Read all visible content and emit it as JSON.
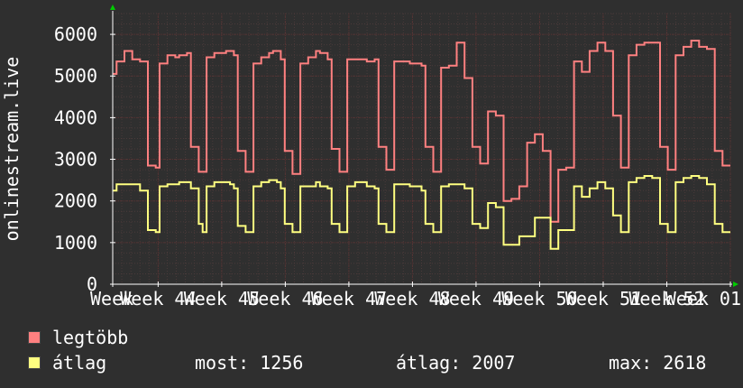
{
  "chart_data": {
    "type": "line",
    "ylabel": "onlinestream.live",
    "ylim": [
      0,
      6500
    ],
    "yticks": [
      0,
      1000,
      2000,
      3000,
      4000,
      5000,
      6000
    ],
    "xlim": [
      0,
      34
    ],
    "xticks": [
      {
        "x": 0,
        "label": "Week"
      },
      {
        "x": 2.5,
        "label": "Week 44"
      },
      {
        "x": 6,
        "label": "Week 45"
      },
      {
        "x": 9.5,
        "label": "Week 46"
      },
      {
        "x": 13,
        "label": "Week 47"
      },
      {
        "x": 16.5,
        "label": "Week 48"
      },
      {
        "x": 20,
        "label": "Week 49"
      },
      {
        "x": 23.5,
        "label": "Week 50"
      },
      {
        "x": 27,
        "label": "Week 51"
      },
      {
        "x": 30.5,
        "label": "Week 52"
      },
      {
        "x": 34,
        "label": "Week 01"
      }
    ],
    "grid": true,
    "colors": {
      "background": "#2f2f2f",
      "plot_background": "#2f2f2f",
      "grid_minor": "#4a3a3a",
      "grid_major": "#5a3030",
      "axis": "#ffffff",
      "arrow": "#00cc00",
      "max_series": "#ff8080",
      "avg_series": "#ffff80"
    },
    "series": [
      {
        "name": "legtöbb",
        "color": "#ff8080",
        "values": [
          5050,
          5350,
          5350,
          5600,
          5600,
          5400,
          5400,
          5350,
          5350,
          2850,
          2850,
          2800,
          5300,
          5300,
          5500,
          5500,
          5450,
          5500,
          5500,
          5550,
          3300,
          3300,
          2700,
          2700,
          5450,
          5450,
          5550,
          5550,
          5550,
          5600,
          5600,
          5500,
          3200,
          3200,
          2700,
          2700,
          5300,
          5300,
          5450,
          5450,
          5550,
          5600,
          5600,
          5400,
          3200,
          3200,
          2650,
          2650,
          5300,
          5300,
          5450,
          5450,
          5600,
          5550,
          5550,
          5400,
          3250,
          3250,
          2700,
          2700,
          5400,
          5400,
          5400,
          5400,
          5400,
          5350,
          5350,
          5400,
          3300,
          3300,
          2750,
          2750,
          5350,
          5350,
          5350,
          5350,
          5300,
          5300,
          5300,
          5250,
          3300,
          3300,
          2700,
          2700,
          5200,
          5200,
          5250,
          5250,
          5800,
          5800,
          4950,
          4950,
          3300,
          3300,
          2900,
          2900,
          4150,
          4150,
          4050,
          4050,
          2000,
          2000,
          2050,
          2050,
          2350,
          2350,
          3400,
          3400,
          3600,
          3600,
          3200,
          3200,
          1500,
          1500,
          2750,
          2750,
          2800,
          2800,
          5350,
          5350,
          5100,
          5100,
          5600,
          5600,
          5800,
          5800,
          5600,
          5600,
          4050,
          4050,
          2800,
          2800,
          5500,
          5500,
          5750,
          5750,
          5800,
          5800,
          5800,
          5800,
          3300,
          3300,
          2750,
          2750,
          5500,
          5500,
          5700,
          5700,
          5850,
          5850,
          5700,
          5700,
          5650,
          5650,
          3200,
          3200,
          2850,
          2850
        ]
      },
      {
        "name": "átlag",
        "color": "#ffff80",
        "values": [
          2250,
          2400,
          2400,
          2400,
          2400,
          2400,
          2400,
          2250,
          2250,
          1300,
          1300,
          1250,
          2350,
          2350,
          2400,
          2400,
          2400,
          2450,
          2450,
          2450,
          2300,
          2300,
          1450,
          1250,
          2350,
          2350,
          2450,
          2450,
          2450,
          2450,
          2400,
          2300,
          1400,
          1400,
          1250,
          1250,
          2350,
          2350,
          2450,
          2450,
          2500,
          2500,
          2450,
          2300,
          1450,
          1450,
          1250,
          1250,
          2350,
          2350,
          2350,
          2350,
          2450,
          2350,
          2350,
          2300,
          1450,
          1450,
          1250,
          1250,
          2350,
          2350,
          2450,
          2450,
          2450,
          2350,
          2350,
          2300,
          1450,
          1450,
          1250,
          1250,
          2400,
          2400,
          2400,
          2400,
          2350,
          2350,
          2350,
          2250,
          1450,
          1450,
          1250,
          1250,
          2350,
          2350,
          2400,
          2400,
          2400,
          2400,
          2300,
          2300,
          1450,
          1450,
          1350,
          1350,
          1950,
          1950,
          1850,
          1850,
          950,
          950,
          950,
          950,
          1150,
          1150,
          1150,
          1150,
          1600,
          1600,
          1600,
          1600,
          850,
          850,
          1300,
          1300,
          1300,
          1300,
          2350,
          2350,
          2100,
          2100,
          2300,
          2300,
          2450,
          2450,
          2300,
          2300,
          1650,
          1650,
          1250,
          1250,
          2450,
          2450,
          2550,
          2550,
          2600,
          2600,
          2550,
          2550,
          1450,
          1450,
          1250,
          1250,
          2450,
          2450,
          2550,
          2550,
          2600,
          2600,
          2550,
          2550,
          2400,
          2400,
          1450,
          1450,
          1250,
          1250
        ]
      }
    ]
  },
  "legend": {
    "items": [
      {
        "label": "legtöbb",
        "color": "#ff8080"
      },
      {
        "label": "átlag",
        "color": "#ffff80"
      }
    ],
    "stats": {
      "most": "most: 1256",
      "atlag": "átlag: 2007",
      "max": "max: 2618"
    }
  }
}
